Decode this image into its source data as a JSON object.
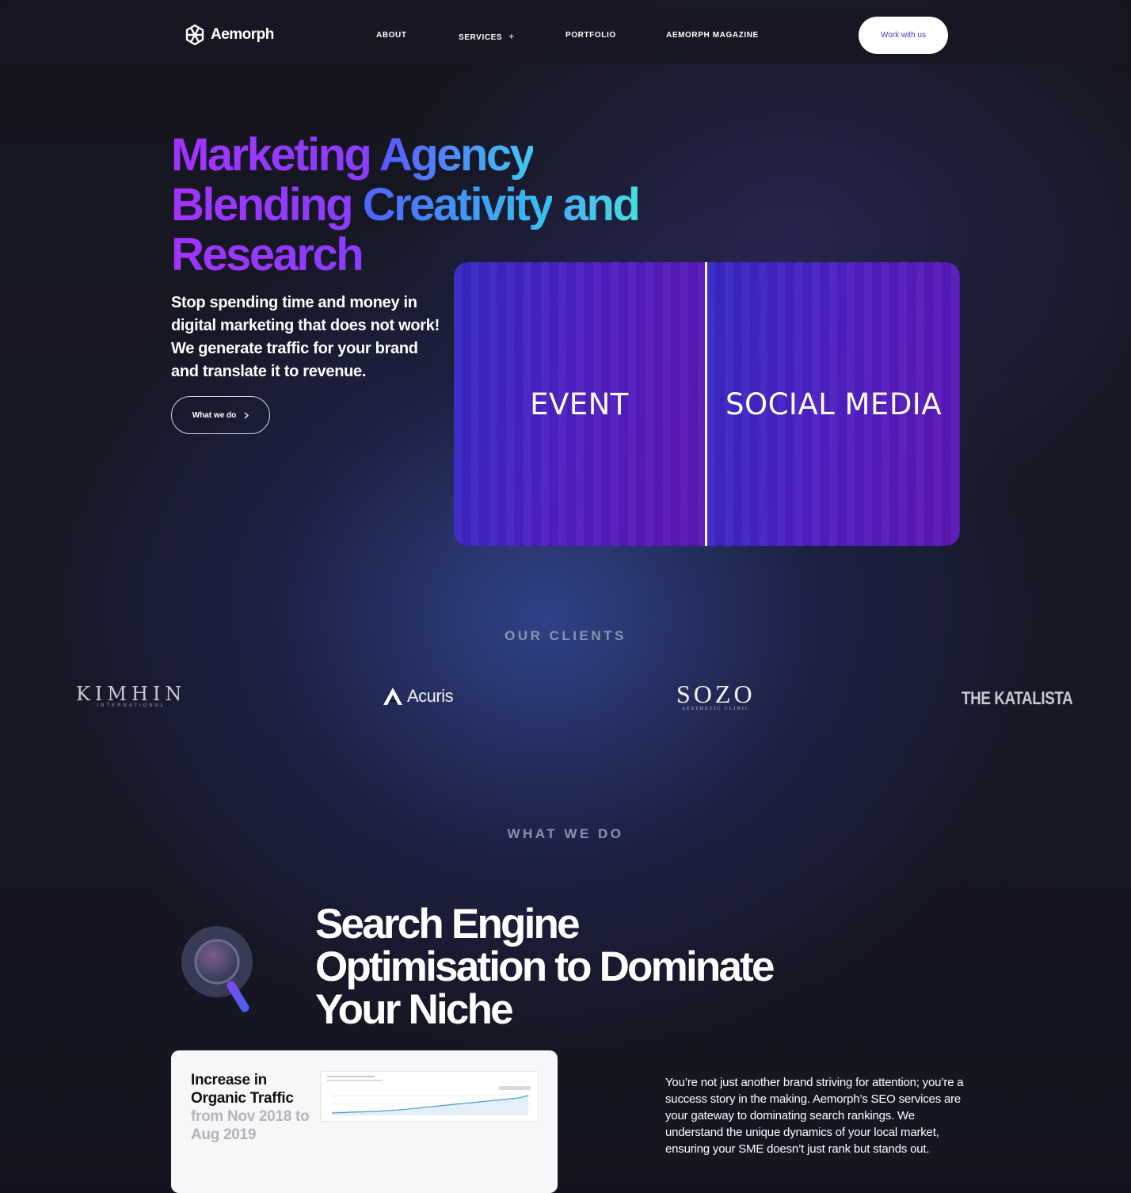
{
  "nav": {
    "brand": "Aemorph",
    "links": [
      "ABOUT",
      "SERVICES",
      "PORTFOLIO",
      "AEMORPH MAGAZINE"
    ],
    "services_toggle": "+",
    "cta": "Work with us"
  },
  "hero": {
    "title_line1_a": "Marketing",
    "title_line1_b": "Agency",
    "title_line2_a": "Blending",
    "title_line2_b": "Creativity",
    "title_line2_c": "and",
    "title_line3": "Research",
    "subtitle": "Stop spending time and money in digital marketing that does not work! We generate traffic for your brand and translate it to revenue.",
    "button_label": "What we do",
    "showcase": {
      "left_label": "EVENT",
      "right_label": "SOCIAL MEDIA"
    }
  },
  "clients": {
    "heading": "OUR CLIENTS",
    "logos": [
      {
        "name": "KIMHIN",
        "tagline": "INTERNATIONAL"
      },
      {
        "name": "Acuris"
      },
      {
        "name": "SOZO",
        "tagline": "AESTHETIC CLINIC"
      },
      {
        "name": "THE KATALISTA"
      }
    ]
  },
  "services": {
    "heading": "WHAT WE DO",
    "seo_title": "Search Engine Optimisation to Dominate Your Niche",
    "seo_icon": "magnifier-icon",
    "card": {
      "title": "Increase in Organic Traffic",
      "range": "from Nov 2018 to Aug 2019"
    },
    "seo_body": "You’re not just another brand striving for attention; you’re a success story in the making. Aemorph’s SEO services are your gateway to dominating search rankings. We understand the unique dynamics of your local market, ensuring your SME doesn’t just rank but stands out."
  },
  "colors": {
    "accent_purple": "#a233ff",
    "accent_cyan": "#40c8f2",
    "background": "#13141f",
    "cta_text": "#4b3bc8"
  }
}
